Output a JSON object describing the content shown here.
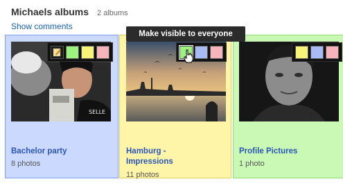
{
  "header": {
    "title": "Michaels albums",
    "count": "2 albums",
    "show_comments": "Show comments"
  },
  "tooltip": "Make visible to everyone",
  "albums": [
    {
      "title": "Bachelor party",
      "meta": "8 photos",
      "color": "#cbd9ff"
    },
    {
      "title_line1": "Hamburg -",
      "title_line2": "Impressions",
      "meta": "11 photos",
      "color": "#fff5a8"
    },
    {
      "title": "Profile Pictures",
      "meta": "1 photo",
      "color": "#c9f9b4"
    }
  ]
}
